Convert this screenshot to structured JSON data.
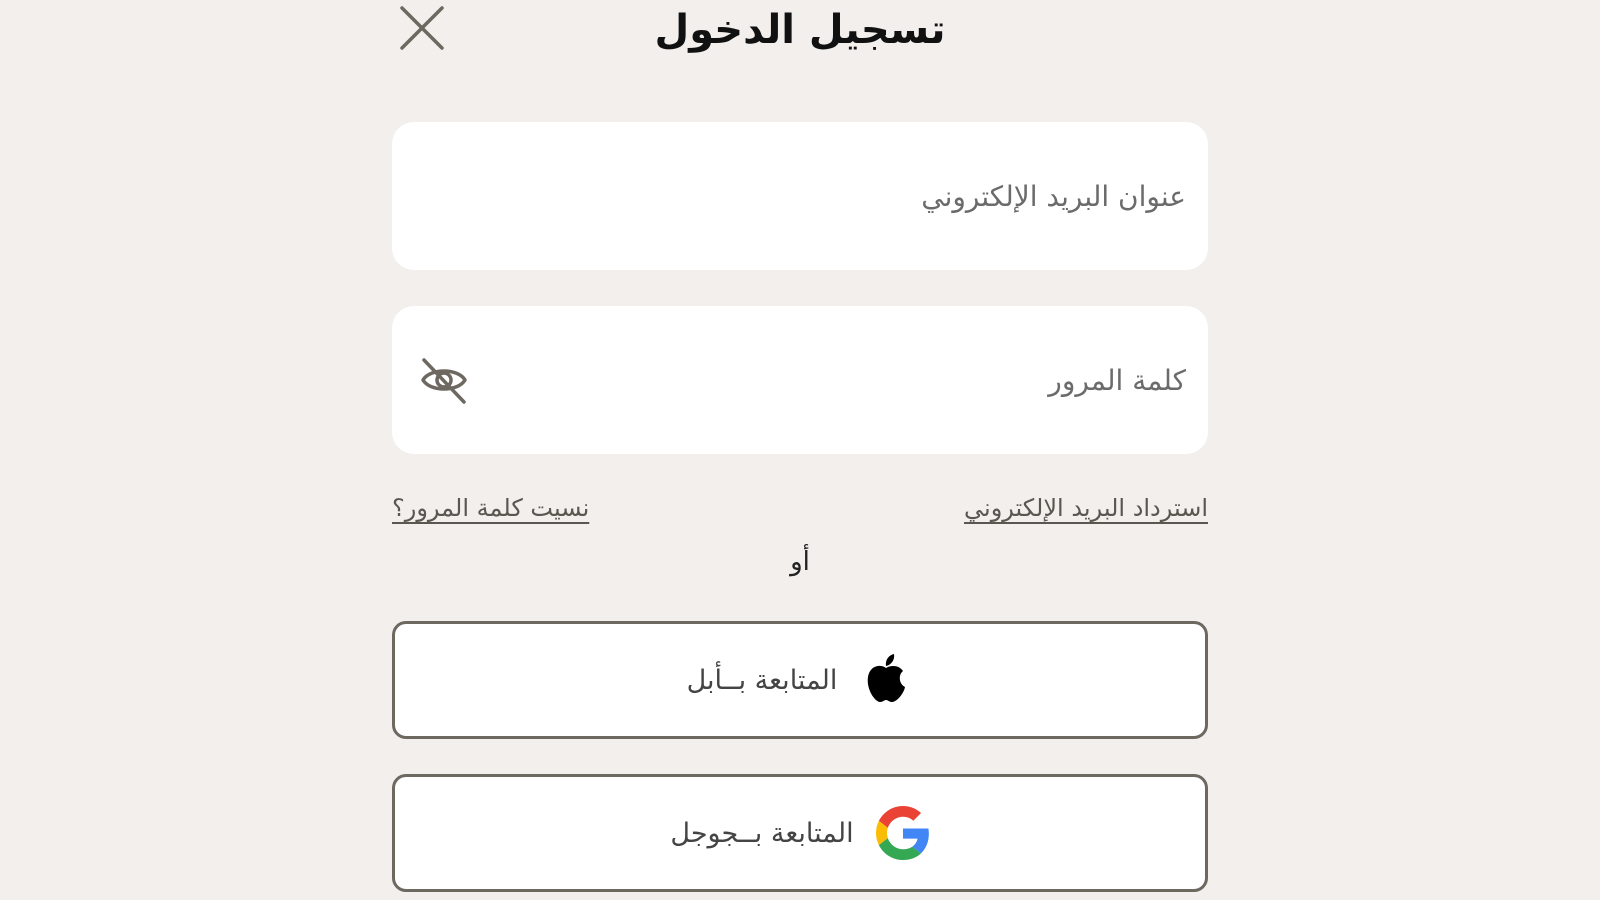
{
  "header": {
    "title": "تسجيل الدخول"
  },
  "form": {
    "email_placeholder": "عنوان البريد الإلكتروني",
    "password_placeholder": "كلمة المرور"
  },
  "links": {
    "forgot_password": "نسيت كلمة المرور؟",
    "recover_email": "استرداد البريد الإلكتروني"
  },
  "divider": {
    "or": "أو"
  },
  "social": {
    "apple_label": "المتابعة بــأبل",
    "google_label": "المتابعة بــجوجل"
  },
  "icons": {
    "close": "close-icon",
    "password_visibility": "eye-off-icon",
    "apple": "apple-logo-icon",
    "google": "google-logo-icon"
  },
  "colors": {
    "background": "#f2efed",
    "field_background": "#ffffff",
    "text_primary": "#111111",
    "text_muted": "#6b6b6b",
    "button_border": "#6d6860",
    "google_blue": "#4285F4",
    "google_red": "#EA4335",
    "google_yellow": "#FBBC05",
    "google_green": "#34A853"
  }
}
